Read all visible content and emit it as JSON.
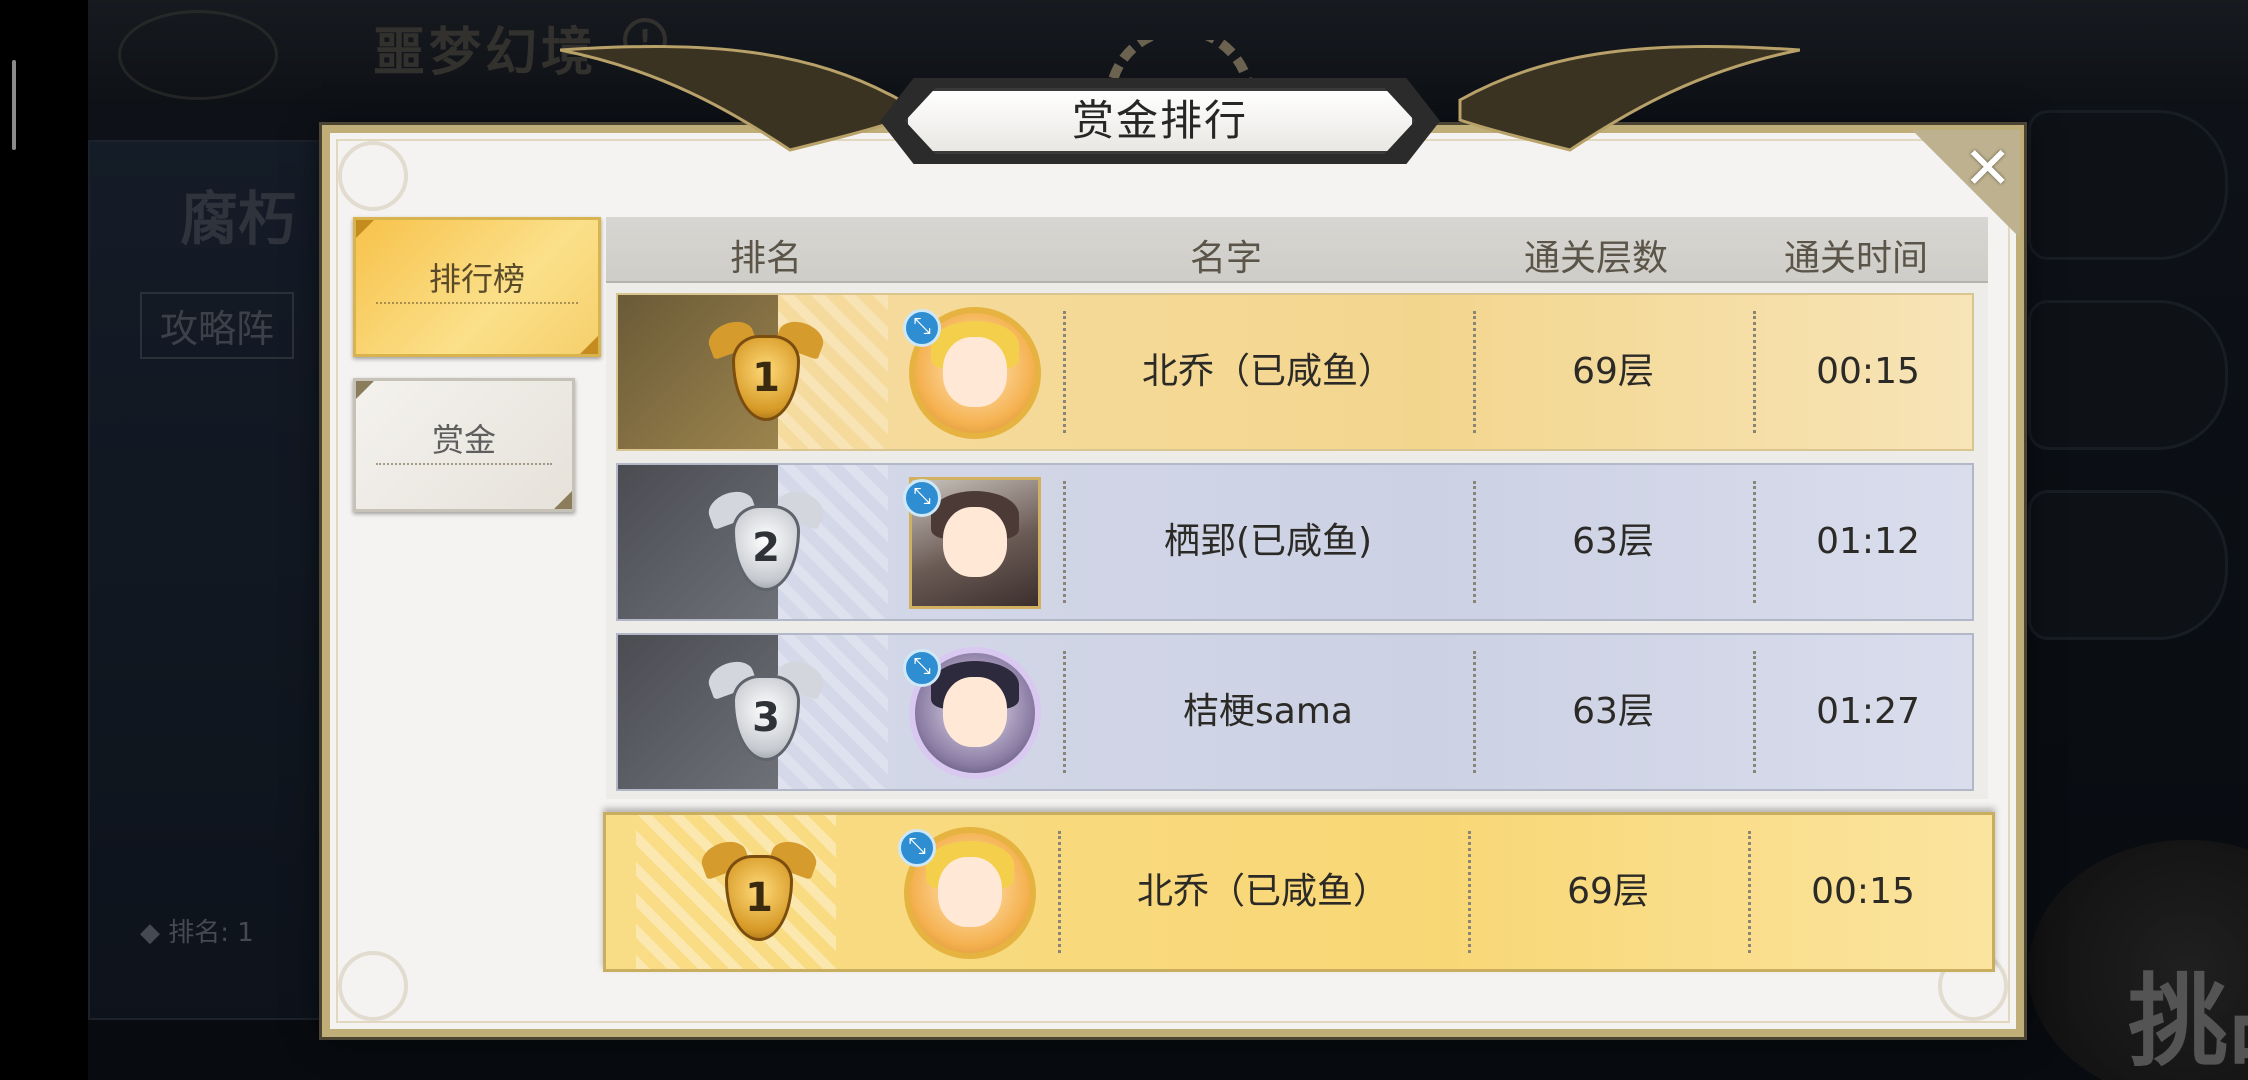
{
  "background": {
    "title": "噩梦幻境",
    "info_icon": "!",
    "panel_title": "腐朽",
    "panel_button": "攻略阵",
    "panel_rank": "◆ 排名: 1",
    "challenge_label": "挑战"
  },
  "dialog": {
    "title": "赏金排行",
    "close_icon": "✕"
  },
  "tabs": [
    {
      "label": "排行榜",
      "active": true
    },
    {
      "label": "赏金",
      "active": false
    }
  ],
  "table": {
    "headers": {
      "rank": "排名",
      "name": "名字",
      "floors": "通关层数",
      "time": "通关时间"
    },
    "rows": [
      {
        "rank": "1",
        "name": "北乔（已咸鱼）",
        "floors": "69层",
        "time": "00:15",
        "tier": "gold"
      },
      {
        "rank": "2",
        "name": "栖郢(已咸鱼)",
        "floors": "63层",
        "time": "01:12",
        "tier": "silver"
      },
      {
        "rank": "3",
        "name": "桔梗sama",
        "floors": "63层",
        "time": "01:27",
        "tier": "silver"
      }
    ],
    "self": {
      "rank": "1",
      "name": "北乔（已咸鱼）",
      "floors": "69层",
      "time": "00:15"
    }
  },
  "colors": {
    "gold": "#f3d68e",
    "silver": "#ccd1e4",
    "frame": "#bfae78"
  }
}
